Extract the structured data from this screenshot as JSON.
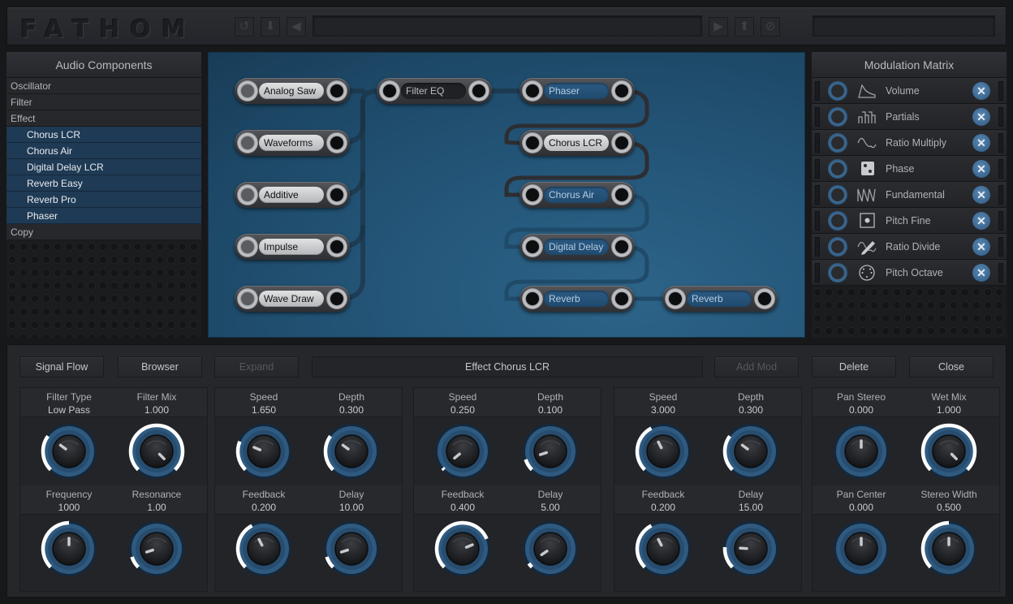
{
  "app": {
    "logo": "FATHOM"
  },
  "toolbar": {
    "buttons": [
      {
        "name": "undo",
        "glyph": "↺"
      },
      {
        "name": "save",
        "glyph": "⬇"
      },
      {
        "name": "prev-preset",
        "glyph": "◀"
      },
      {
        "name": "next-preset",
        "glyph": "▶"
      },
      {
        "name": "load",
        "glyph": "⬆"
      },
      {
        "name": "clear",
        "glyph": "⊘"
      }
    ],
    "preset_name": "",
    "search_value": ""
  },
  "components": {
    "title": "Audio Components",
    "items": [
      {
        "label": "Oscillator",
        "sub": false
      },
      {
        "label": "Filter",
        "sub": false
      },
      {
        "label": "Effect",
        "sub": false
      },
      {
        "label": "Chorus LCR",
        "sub": true
      },
      {
        "label": "Chorus Air",
        "sub": true
      },
      {
        "label": "Digital Delay LCR",
        "sub": true
      },
      {
        "label": "Reverb Easy",
        "sub": true
      },
      {
        "label": "Reverb Pro",
        "sub": true
      },
      {
        "label": "Phaser",
        "sub": true
      },
      {
        "label": "Copy",
        "sub": false
      }
    ]
  },
  "signal_flow": {
    "nodes": [
      {
        "id": "analog-saw",
        "label": "Analog Saw",
        "style": "light"
      },
      {
        "id": "waveforms",
        "label": "Waveforms",
        "style": "light"
      },
      {
        "id": "additive",
        "label": "Additive",
        "style": "light"
      },
      {
        "id": "impulse",
        "label": "Impulse",
        "style": "light"
      },
      {
        "id": "wave-draw",
        "label": "Wave Draw",
        "style": "light"
      },
      {
        "id": "filter-eq",
        "label": "Filter EQ",
        "style": "dark"
      },
      {
        "id": "phaser",
        "label": "Phaser",
        "style": "blue"
      },
      {
        "id": "chorus-lcr",
        "label": "Chorus LCR",
        "style": "selected"
      },
      {
        "id": "chorus-air",
        "label": "Chorus Air",
        "style": "blue"
      },
      {
        "id": "digital-delay",
        "label": "Digital Delay",
        "style": "blue"
      },
      {
        "id": "reverb-1",
        "label": "Reverb",
        "style": "blue"
      },
      {
        "id": "reverb-2",
        "label": "Reverb",
        "style": "blue"
      }
    ]
  },
  "modulation": {
    "title": "Modulation Matrix",
    "items": [
      {
        "label": "Volume",
        "icon": "envelope-icon"
      },
      {
        "label": "Partials",
        "icon": "bars-icon"
      },
      {
        "label": "Ratio Multiply",
        "icon": "sine-wave-icon"
      },
      {
        "label": "Phase",
        "icon": "dice-icon"
      },
      {
        "label": "Fundamental",
        "icon": "sawtooth-icon"
      },
      {
        "label": "Pitch Fine",
        "icon": "point-box-icon"
      },
      {
        "label": "Ratio Divide",
        "icon": "pencil-wave-icon"
      },
      {
        "label": "Pitch Octave",
        "icon": "midi-icon"
      }
    ],
    "remove_glyph": "✕"
  },
  "bottom": {
    "buttons": {
      "signal_flow": "Signal Flow",
      "browser": "Browser",
      "expand": "Expand",
      "add_mod": "Add Mod",
      "delete": "Delete",
      "close": "Close"
    },
    "effect_title": "Effect Chorus LCR",
    "groups": [
      {
        "params": [
          {
            "label": "Filter Type",
            "value": "Low Pass",
            "amount": 0.3
          },
          {
            "label": "Filter Mix",
            "value": "1.000",
            "amount": 1.0
          },
          {
            "label": "Frequency",
            "value": "1000",
            "amount": 0.5
          },
          {
            "label": "Resonance",
            "value": "1.00",
            "amount": 0.1
          }
        ]
      },
      {
        "params": [
          {
            "label": "Speed",
            "value": "1.650",
            "amount": 0.25
          },
          {
            "label": "Depth",
            "value": "0.300",
            "amount": 0.3
          },
          {
            "label": "Feedback",
            "value": "0.200",
            "amount": 0.4
          },
          {
            "label": "Delay",
            "value": "10.00",
            "amount": 0.1
          }
        ]
      },
      {
        "params": [
          {
            "label": "Speed",
            "value": "0.250",
            "amount": 0.02
          },
          {
            "label": "Depth",
            "value": "0.100",
            "amount": 0.1
          },
          {
            "label": "Feedback",
            "value": "0.400",
            "amount": 0.75
          },
          {
            "label": "Delay",
            "value": "5.00",
            "amount": 0.04
          }
        ]
      },
      {
        "params": [
          {
            "label": "Speed",
            "value": "3.000",
            "amount": 0.4
          },
          {
            "label": "Depth",
            "value": "0.300",
            "amount": 0.3
          },
          {
            "label": "Feedback",
            "value": "0.200",
            "amount": 0.4
          },
          {
            "label": "Delay",
            "value": "15.00",
            "amount": 0.18
          }
        ]
      },
      {
        "params": [
          {
            "label": "Pan Stereo",
            "value": "0.000",
            "amount": 0.5,
            "bipolar": true
          },
          {
            "label": "Wet Mix",
            "value": "1.000",
            "amount": 1.0
          },
          {
            "label": "Pan Center",
            "value": "0.000",
            "amount": 0.5,
            "bipolar": true
          },
          {
            "label": "Stereo Width",
            "value": "0.500",
            "amount": 0.5
          }
        ]
      }
    ]
  },
  "colors": {
    "accent_blue": "#2f5a80",
    "canvas_blue": "#245679",
    "knob_arc": "#ffffff"
  }
}
